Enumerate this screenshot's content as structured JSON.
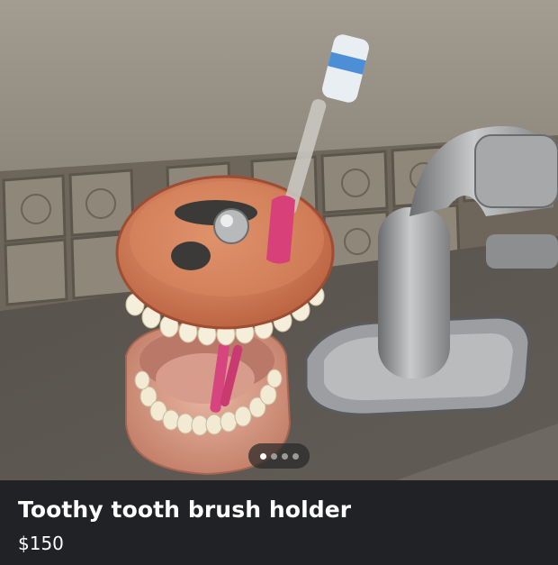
{
  "listing": {
    "title": "Toothy tooth brush holder",
    "price": "$150"
  },
  "gallery": {
    "image_count": 4,
    "active_index": 0,
    "subject": "denture-shaped toothbrush holder beside a faucet"
  },
  "colors": {
    "info_background": "#202225",
    "text": "#ffffff"
  }
}
